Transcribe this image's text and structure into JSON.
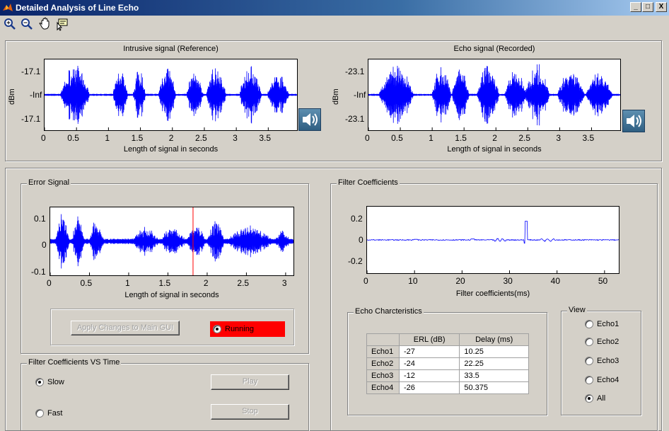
{
  "window": {
    "title": "Detailed Analysis of Line Echo"
  },
  "window_buttons": {
    "minimize": "_",
    "maximize": "□",
    "close": "X"
  },
  "toolbar": {
    "icons": [
      "zoom-in-icon",
      "zoom-out-icon",
      "pan-icon",
      "data-cursor-icon"
    ]
  },
  "top_panel": {
    "intrusive": {
      "title": "Intrusive signal (Reference)",
      "ylabel": "dBm",
      "yticks": [
        "-17.1",
        "-Inf",
        "-17.1"
      ],
      "xticks": [
        "0",
        "0.5",
        "1",
        "1.5",
        "2",
        "2.5",
        "3",
        "3.5"
      ],
      "xlabel": "Length of signal in seconds"
    },
    "echo": {
      "title": "Echo signal (Recorded)",
      "ylabel": "dBm",
      "yticks": [
        "-23.1",
        "-Inf",
        "-23.1"
      ],
      "xticks": [
        "0",
        "0.5",
        "1",
        "1.5",
        "2",
        "2.5",
        "3",
        "3.5"
      ],
      "xlabel": "Length of signal in seconds"
    }
  },
  "error_signal": {
    "legend": "Error Signal",
    "yticks": [
      "0.1",
      "0",
      "-0.1"
    ],
    "xticks": [
      "0",
      "0.5",
      "1",
      "1.5",
      "2",
      "2.5",
      "3"
    ],
    "xlabel": "Length of signal in seconds",
    "apply_button": "Apply Changes to Main GUI",
    "running_label": "Running",
    "cursor_seconds": 1.82
  },
  "filter_vs_time": {
    "legend": "Filter Coefficients VS Time",
    "slow_label": "Slow",
    "fast_label": "Fast",
    "play_button": "Play",
    "stop_button": "Stop",
    "selected": "slow"
  },
  "filter_coefficients": {
    "legend": "Filter Coefficients",
    "yticks": [
      "0.2",
      "0",
      "-0.2"
    ],
    "xticks": [
      "0",
      "10",
      "20",
      "30",
      "40",
      "50"
    ],
    "xlabel": "Filter coefficients(ms)"
  },
  "echo_characteristics": {
    "legend": "Echo Charcteristics",
    "columns": [
      "ERL (dB)",
      "Delay (ms)"
    ],
    "rows": [
      {
        "name": "Echo1",
        "erl": "-27",
        "delay": "10.25"
      },
      {
        "name": "Echo2",
        "erl": "-24",
        "delay": "22.25"
      },
      {
        "name": "Echo3",
        "erl": "-12",
        "delay": "33.5"
      },
      {
        "name": "Echo4",
        "erl": "-26",
        "delay": "50.375"
      }
    ]
  },
  "view": {
    "legend": "View",
    "options": [
      "Echo1",
      "Echo2",
      "Echo3",
      "Echo4",
      "All"
    ],
    "selected": "All"
  },
  "colors": {
    "signal": "#0000ff",
    "cursor": "#ff0000",
    "running_bg": "#ff0000"
  }
}
